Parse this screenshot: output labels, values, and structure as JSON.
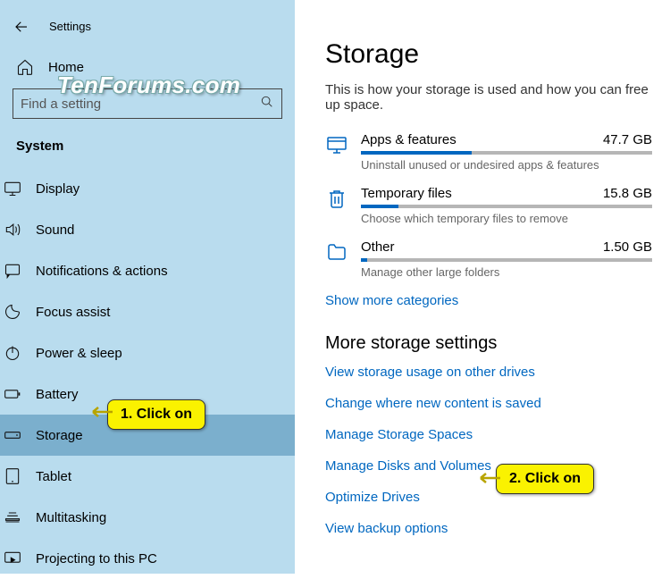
{
  "titlebar": {
    "app_name": "Settings"
  },
  "watermark": "TenForums.com",
  "sidebar": {
    "home": "Home",
    "search_placeholder": "Find a setting",
    "category": "System",
    "items": [
      {
        "label": "Display"
      },
      {
        "label": "Sound"
      },
      {
        "label": "Notifications & actions"
      },
      {
        "label": "Focus assist"
      },
      {
        "label": "Power & sleep"
      },
      {
        "label": "Battery"
      },
      {
        "label": "Storage"
      },
      {
        "label": "Tablet"
      },
      {
        "label": "Multitasking"
      },
      {
        "label": "Projecting to this PC"
      }
    ]
  },
  "main": {
    "title": "Storage",
    "description": "This is how your storage is used and how you can free up space.",
    "storage_items": [
      {
        "label": "Apps & features",
        "size": "47.7 GB",
        "hint": "Uninstall unused or undesired apps & features",
        "fill_pct": 38
      },
      {
        "label": "Temporary files",
        "size": "15.8 GB",
        "hint": "Choose which temporary files to remove",
        "fill_pct": 13
      },
      {
        "label": "Other",
        "size": "1.50 GB",
        "hint": "Manage other large folders",
        "fill_pct": 2
      }
    ],
    "show_more": "Show more categories",
    "more_heading": "More storage settings",
    "links": [
      "View storage usage on other drives",
      "Change where new content is saved",
      "Manage Storage Spaces",
      "Manage Disks and Volumes",
      "Optimize Drives",
      "View backup options"
    ]
  },
  "annotations": {
    "callout1": "1. Click on",
    "callout2": "2. Click on"
  }
}
